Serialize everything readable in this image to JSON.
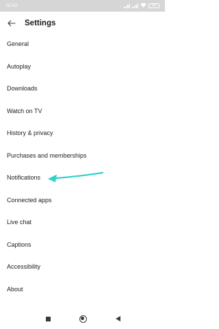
{
  "status_bar": {
    "time": "10:42",
    "battery": "38"
  },
  "header": {
    "title": "Settings"
  },
  "menu": {
    "items": [
      {
        "label": "General"
      },
      {
        "label": "Autoplay"
      },
      {
        "label": "Downloads"
      },
      {
        "label": "Watch on TV"
      },
      {
        "label": "History & privacy"
      },
      {
        "label": "Purchases and memberships"
      },
      {
        "label": "Notifications"
      },
      {
        "label": "Connected apps"
      },
      {
        "label": "Live chat"
      },
      {
        "label": "Captions"
      },
      {
        "label": "Accessibility"
      },
      {
        "label": "About"
      }
    ]
  },
  "annotation": {
    "arrow_color": "#2fd3c7"
  },
  "nav_bar": {
    "icons": [
      "recents-square-icon",
      "home-circle-icon",
      "back-triangle-icon"
    ]
  }
}
